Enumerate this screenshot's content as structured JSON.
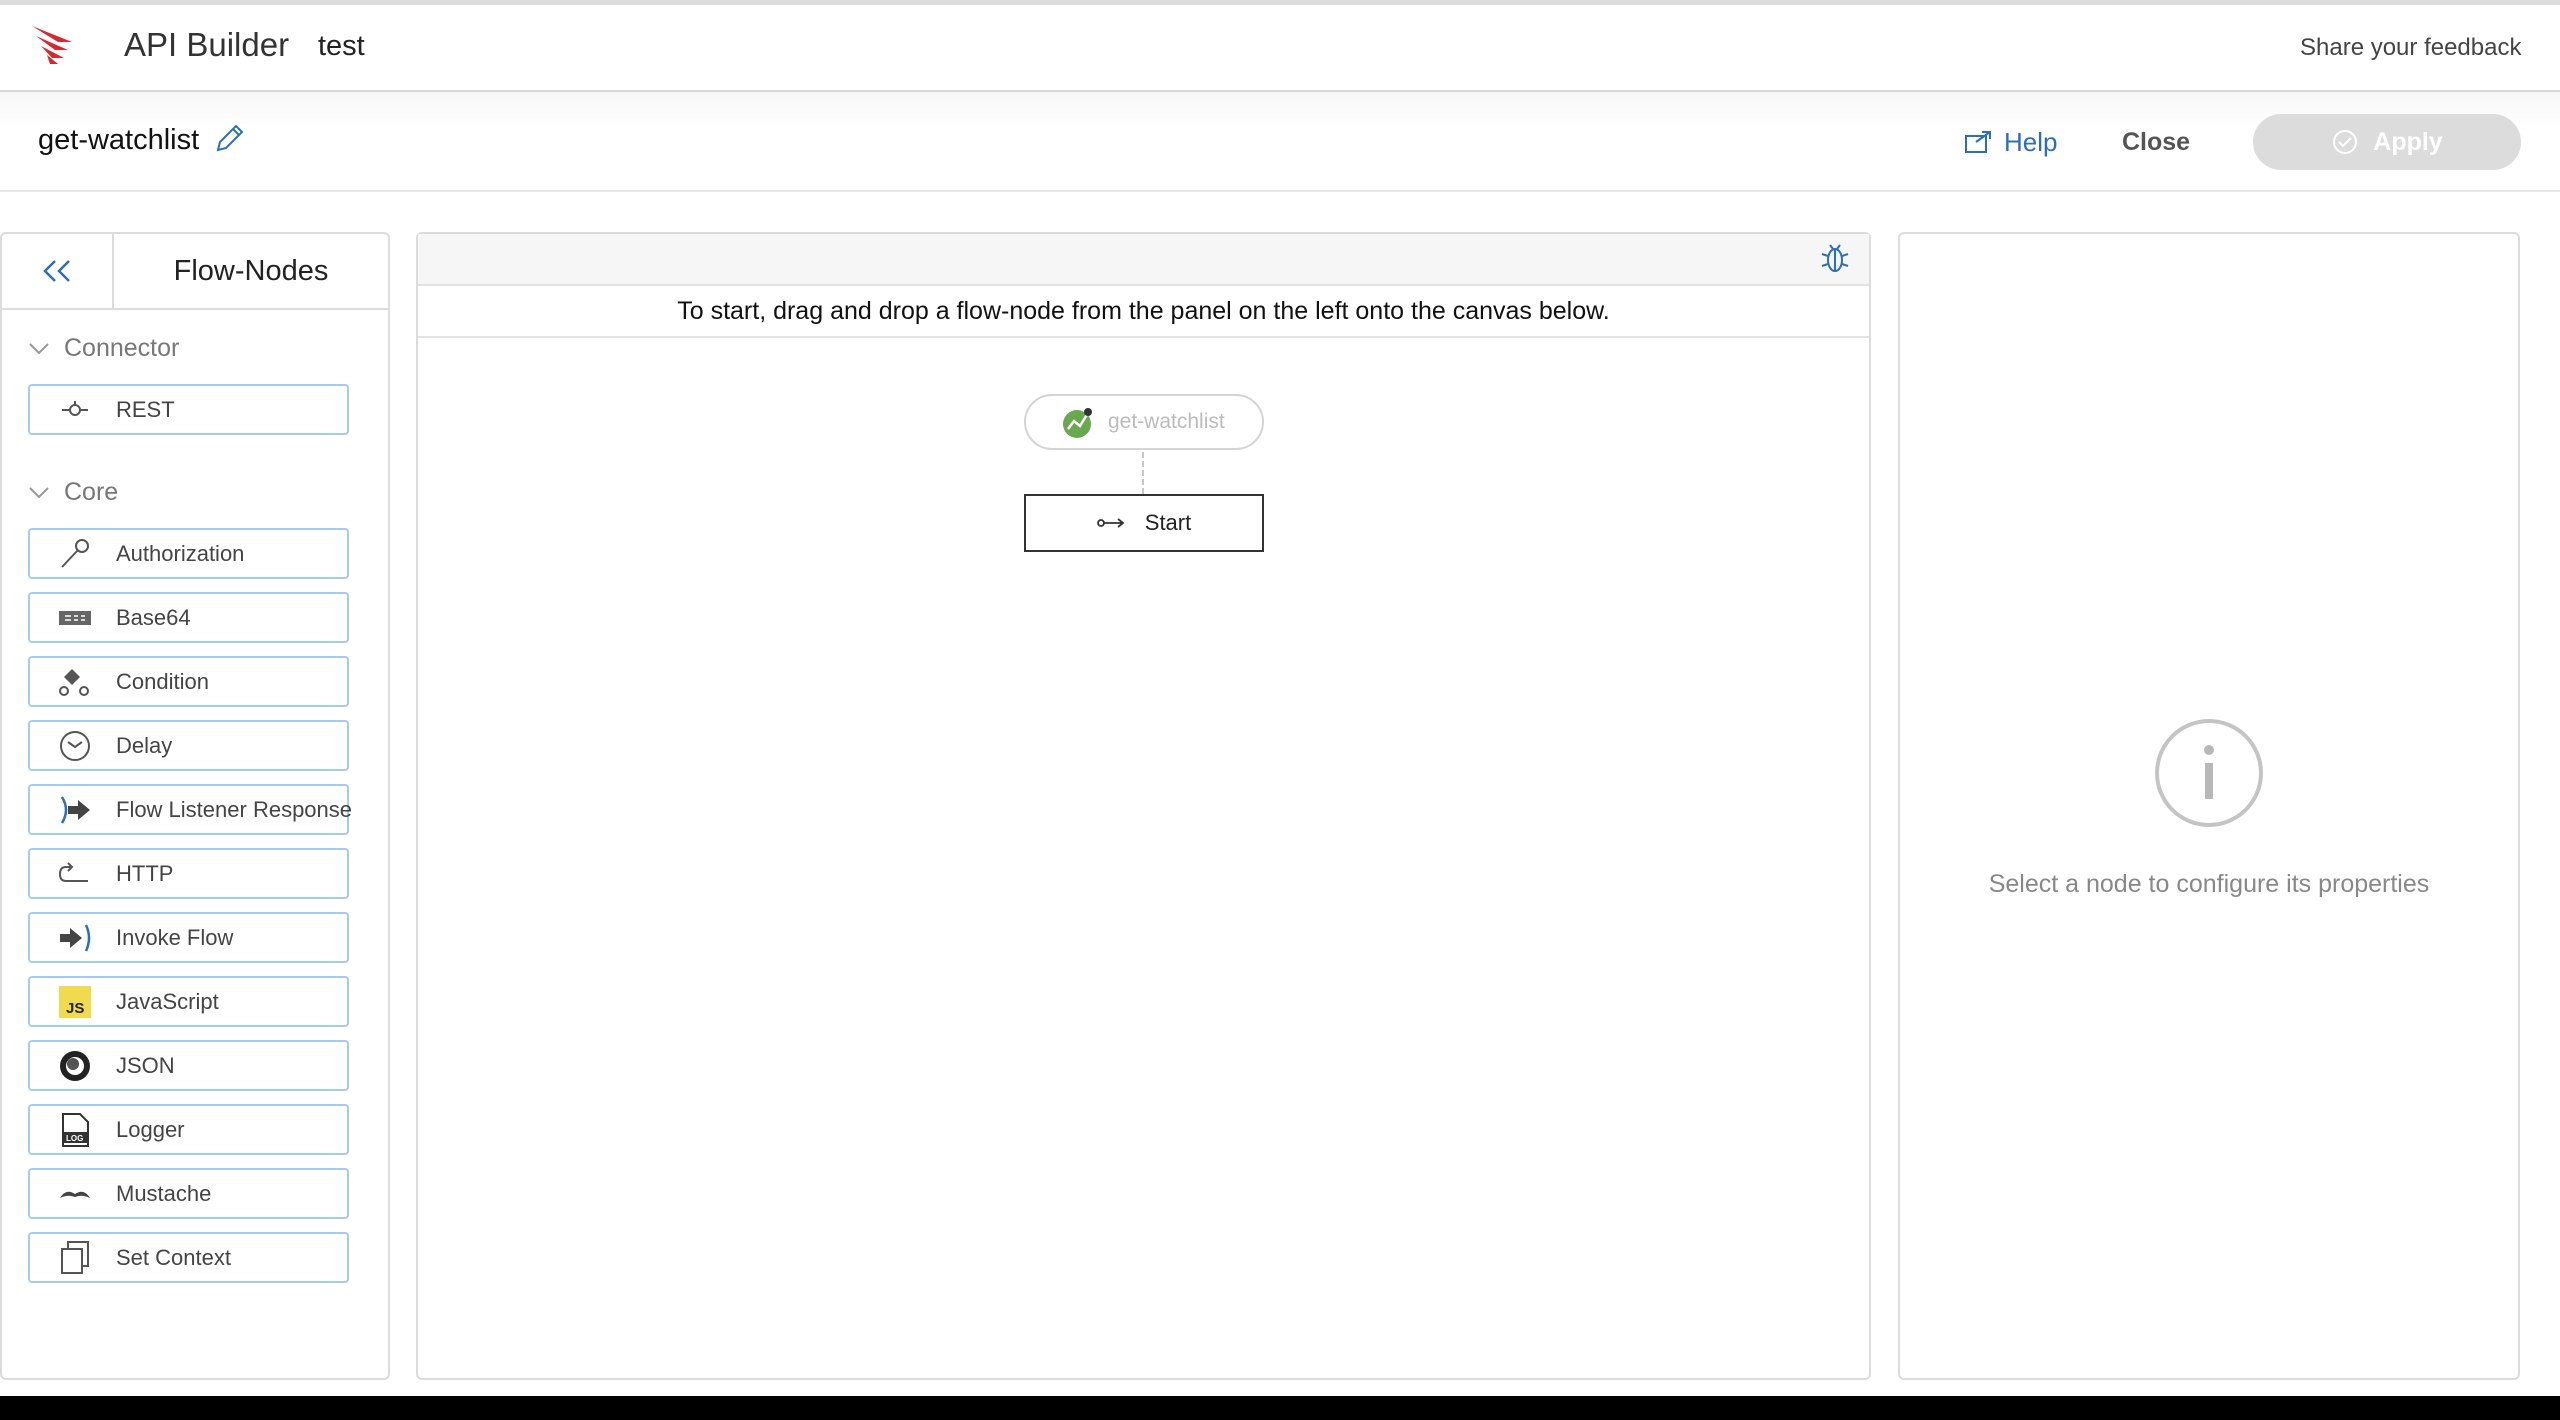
{
  "app": {
    "title": "API Builder",
    "project": "test",
    "feedback_link": "Share your feedback",
    "brand_color": "#d8282f"
  },
  "flow": {
    "name": "get-watchlist",
    "help_label": "Help",
    "close_label": "Close",
    "apply_label": "Apply"
  },
  "palette": {
    "title": "Flow-Nodes",
    "groups": [
      {
        "label": "Connector",
        "items": [
          {
            "label": "REST",
            "icon": "rest-icon"
          }
        ]
      },
      {
        "label": "Core",
        "items": [
          {
            "label": "Authorization",
            "icon": "key-icon"
          },
          {
            "label": "Base64",
            "icon": "base64-icon"
          },
          {
            "label": "Condition",
            "icon": "condition-icon"
          },
          {
            "label": "Delay",
            "icon": "clock-icon"
          },
          {
            "label": "Flow Listener Response",
            "icon": "flow-listener-response-icon"
          },
          {
            "label": "HTTP",
            "icon": "http-icon"
          },
          {
            "label": "Invoke Flow",
            "icon": "invoke-flow-icon"
          },
          {
            "label": "JavaScript",
            "icon": "javascript-icon"
          },
          {
            "label": "JSON",
            "icon": "json-icon"
          },
          {
            "label": "Logger",
            "icon": "logger-icon"
          },
          {
            "label": "Mustache",
            "icon": "mustache-icon"
          },
          {
            "label": "Set Context",
            "icon": "set-context-icon"
          }
        ]
      }
    ]
  },
  "canvas": {
    "hint": "To start, drag and drop a flow-node from the panel on the left onto the canvas below.",
    "flow_node_label": "get-watchlist",
    "start_label": "Start"
  },
  "properties": {
    "empty_hint": "Select a node to configure its properties"
  }
}
